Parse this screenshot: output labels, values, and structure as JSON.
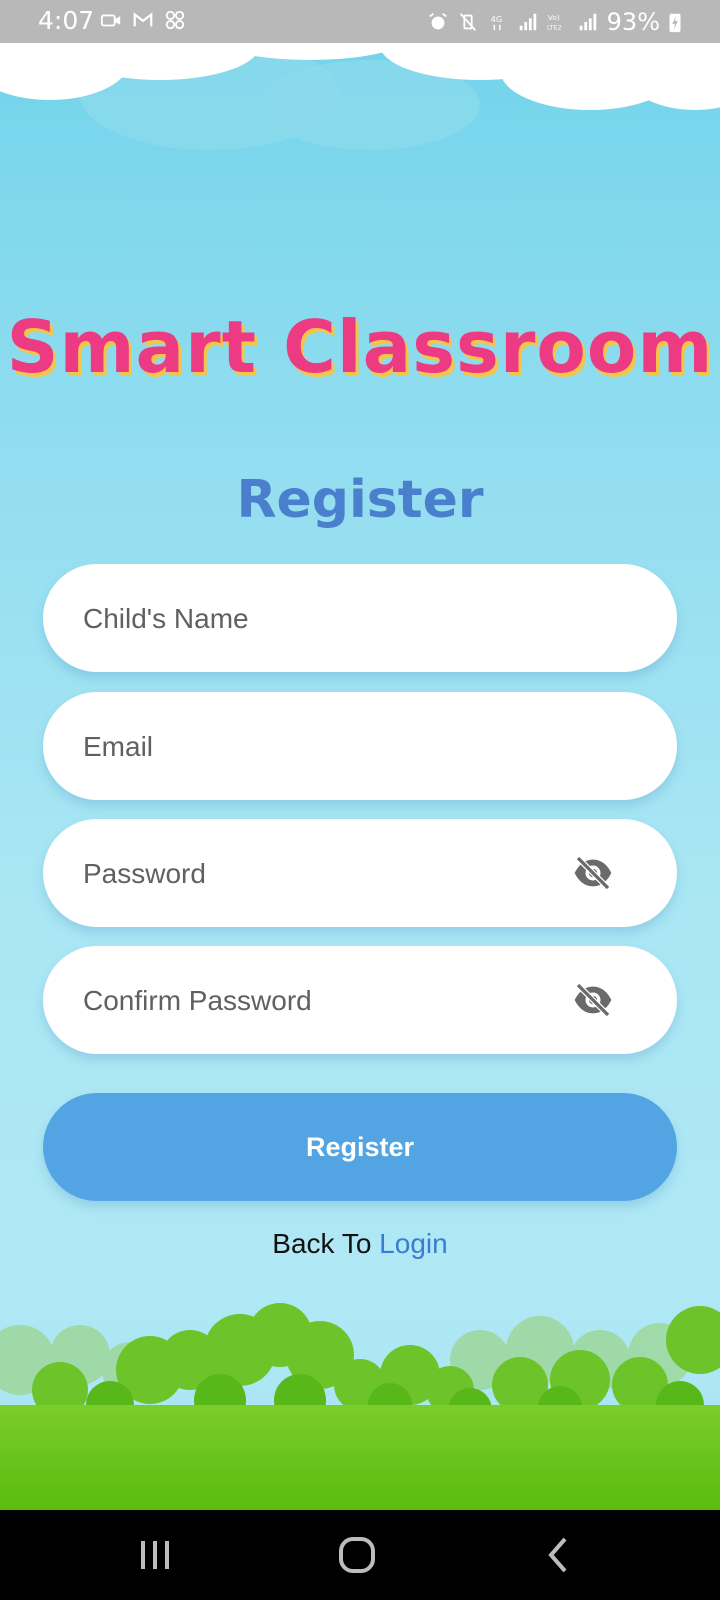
{
  "status_bar": {
    "time": "4:07",
    "battery": "93%",
    "left_icons": [
      "video-call-icon",
      "gmail-icon",
      "app-grid-icon"
    ],
    "right_icons": [
      "alarm-icon",
      "vibrate-mute-icon",
      "4g-data-icon",
      "signal-icon",
      "volte-lte2-icon",
      "signal-icon",
      "battery-charging-icon"
    ]
  },
  "app": {
    "title": "Smart Classroom"
  },
  "form": {
    "heading": "Register",
    "fields": {
      "child_name_placeholder": "Child's Name",
      "email_placeholder": "Email",
      "password_placeholder": "Password",
      "confirm_password_placeholder": "Confirm Password"
    },
    "visibility_icon": "eye-off-icon",
    "submit_label": "Register"
  },
  "footer": {
    "back_prefix": "Back To",
    "login_link": "Login"
  },
  "nav_bar": {
    "buttons": [
      "recents-icon",
      "home-icon",
      "back-icon"
    ]
  },
  "colors": {
    "title_pink": "#ec3a83",
    "title_shadow": "#f3c64a",
    "heading_blue": "#4a7fcd",
    "button_blue": "#52a5e2",
    "link_blue": "#3c7cd0",
    "sky": "#a9e6f4",
    "grass": "#6ac41c"
  }
}
